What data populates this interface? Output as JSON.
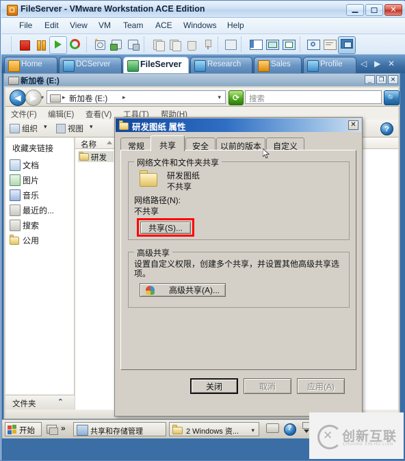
{
  "vmware": {
    "title": "FileServer - VMware Workstation ACE Edition",
    "window_icon": "vmware-icon",
    "controls": {
      "minimize": "–",
      "maximize": "□",
      "close": "✕"
    },
    "menus": [
      "File",
      "Edit",
      "View",
      "VM",
      "Team",
      "ACE",
      "Windows",
      "Help"
    ],
    "toolbar_icons": [
      "stop-icon",
      "pause-icon",
      "play-icon",
      "reset-icon",
      "snapshot-take-icon",
      "snapshot-revert-icon",
      "snapshot-manager-icon",
      "clone-icon",
      "clone-linked-icon",
      "delete-vm-icon",
      "usb-device-icon",
      "send-ctrl-alt-del-icon",
      "sidebar-toggle-icon",
      "fullscreen-icon",
      "quick-switch-icon",
      "settings-icon",
      "summary-icon",
      "console-icon"
    ],
    "tabs": [
      {
        "label": "Home",
        "icon": "home-icon",
        "active": false
      },
      {
        "label": "DCServer",
        "icon": "vm-icon",
        "active": false
      },
      {
        "label": "FileServer",
        "icon": "vm-icon",
        "active": true
      },
      {
        "label": "Research",
        "icon": "vm-icon",
        "active": false
      },
      {
        "label": "Sales",
        "icon": "vm-icon-suspended",
        "active": false
      },
      {
        "label": "Profile",
        "icon": "vm-icon",
        "active": false
      }
    ],
    "tab_nav": {
      "prev": "◁",
      "next": "▶",
      "close": "✕"
    }
  },
  "explorer": {
    "title": "新加卷 (E:)",
    "title_icon": "drive-icon",
    "controls": {
      "minimize": "_",
      "restore": "❐",
      "close": "✕"
    },
    "nav": {
      "back": "◀",
      "forward": "▶",
      "dropdown": "▾",
      "address_icon": "drive-icon",
      "address_segments": [
        "新加卷 (E:)"
      ],
      "address_chevron": "▸",
      "address_dropdown": "▾",
      "refresh": "refresh-icon",
      "search_placeholder": "搜索",
      "search_button": "search-icon"
    },
    "menus": [
      "文件(F)",
      "编辑(E)",
      "查看(V)",
      "工具(T)",
      "帮助(H)"
    ],
    "commandbar": {
      "organize": "组织",
      "organize_chevron": "▾",
      "views": "视图",
      "views_chevron": "▾",
      "help_button": "help-icon"
    },
    "sidebar": {
      "header": "收藏夹链接",
      "items": [
        {
          "label": "文档",
          "icon": "documents-icon"
        },
        {
          "label": "图片",
          "icon": "pictures-icon"
        },
        {
          "label": "音乐",
          "icon": "music-icon"
        },
        {
          "label": "最近的...",
          "icon": "recent-places-icon"
        },
        {
          "label": "搜索",
          "icon": "searches-icon"
        },
        {
          "label": "公用",
          "icon": "public-folder-icon"
        }
      ],
      "folders_pane": {
        "label": "文件夹",
        "chevron": "⌃"
      }
    },
    "list": {
      "columns": [
        "名称"
      ],
      "sort_arrow": "▲",
      "rows": [
        {
          "name": "研发",
          "icon": "folder-icon",
          "selected": true
        }
      ]
    }
  },
  "dialog": {
    "title": "研发图纸  属性",
    "title_icon": "folder-icon",
    "close_label": "✕",
    "tabs": [
      {
        "label": "常规",
        "active": false
      },
      {
        "label": "共享",
        "active": true
      },
      {
        "label": "安全",
        "active": false
      },
      {
        "label": "以前的版本",
        "active": false
      },
      {
        "label": "自定义",
        "active": false
      }
    ],
    "network_share_group": {
      "title": "网络文件和文件夹共享",
      "folder_icon": "folder-icon",
      "folder_name": "研发图纸",
      "folder_state": "不共享",
      "network_path_label": "网络路径(N):",
      "network_path_value": "不共享",
      "share_button": "共享(S)...",
      "share_button_highlighted": true,
      "highlight_color": "#ff0000"
    },
    "advanced_share_group": {
      "title": "高级共享",
      "description_line1": "设置自定义权限，创建多个共享，并设置其他高级共享选",
      "description_line2": "项。",
      "button_label": "高级共享(A)...",
      "button_icon": "shield-icon"
    },
    "footer_buttons": [
      {
        "label": "关闭",
        "enabled": true,
        "default": true
      },
      {
        "label": "取消",
        "enabled": false,
        "default": false
      },
      {
        "label": "应用(A)",
        "enabled": false,
        "default": false
      }
    ]
  },
  "taskbar": {
    "start_label": "开始",
    "start_icon": "windows-flag-icon",
    "quicklaunch_icon": "show-desktop-icon",
    "overflow_chevron": "»",
    "buttons": [
      {
        "label": "共享和存储管理",
        "icon": "share-storage-icon"
      },
      {
        "label": "2 Windows 资...",
        "icon": "folder-icon",
        "chevron": "▾"
      }
    ],
    "tray": [
      {
        "icon": "keyboard-icon"
      },
      {
        "icon": "help-icon"
      },
      {
        "icon": "network-icon"
      }
    ]
  },
  "watermark": {
    "cn": "创新互联",
    "en": "CHUANG XIN HU LIAN",
    "mark": "cx-logo-icon"
  }
}
